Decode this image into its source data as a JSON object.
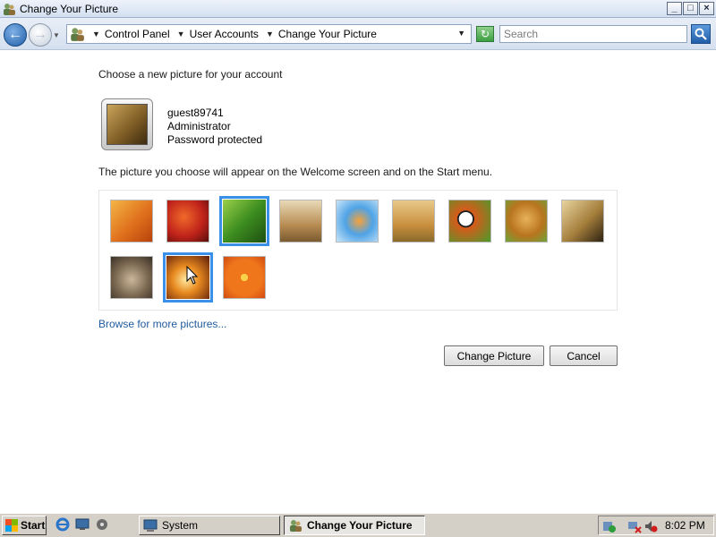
{
  "window": {
    "title": "Change Your Picture",
    "controls": {
      "minimize": "_",
      "maximize": "□",
      "close": "×"
    }
  },
  "address_bar": {
    "breadcrumb": [
      "Control Panel",
      "User Accounts",
      "Change Your Picture"
    ],
    "search_placeholder": "Search"
  },
  "main": {
    "heading": "Choose a new picture for your account",
    "account": {
      "name": "guest89741",
      "role": "Administrator",
      "security": "Password protected"
    },
    "description": "The picture you choose will appear on the Welcome screen and on the Start menu.",
    "pictures": [
      {
        "name": "music-clef-picture",
        "selected": false,
        "row": 0,
        "col": 0
      },
      {
        "name": "red-flower-picture",
        "selected": false,
        "row": 0,
        "col": 1
      },
      {
        "name": "green-leaf-picture",
        "selected": true,
        "row": 0,
        "col": 2
      },
      {
        "name": "robot-toy-picture",
        "selected": false,
        "row": 0,
        "col": 3
      },
      {
        "name": "goldfish-picture",
        "selected": false,
        "row": 0,
        "col": 4
      },
      {
        "name": "bonsai-tree-picture",
        "selected": false,
        "row": 0,
        "col": 5
      },
      {
        "name": "sports-balls-picture",
        "selected": false,
        "row": 0,
        "col": 6
      },
      {
        "name": "dog-picture",
        "selected": false,
        "row": 0,
        "col": 7
      },
      {
        "name": "chess-pieces-picture",
        "selected": false,
        "row": 0,
        "col": 8
      },
      {
        "name": "kitten-picture",
        "selected": false,
        "row": 1,
        "col": 0
      },
      {
        "name": "sparkles-picture",
        "selected": true,
        "row": 1,
        "col": 1
      },
      {
        "name": "orange-daisy-picture",
        "selected": false,
        "row": 1,
        "col": 2
      }
    ],
    "browse_link": "Browse for more pictures...",
    "change_button": "Change Picture",
    "cancel_button": "Cancel"
  },
  "taskbar": {
    "start_label": "Start",
    "tasks": [
      {
        "label": "System",
        "active": false
      },
      {
        "label": "Change Your Picture",
        "active": true
      }
    ],
    "clock": "8:02 PM"
  },
  "colors": {
    "selection_border": "#3a8fe8",
    "link": "#1f5a9e"
  }
}
